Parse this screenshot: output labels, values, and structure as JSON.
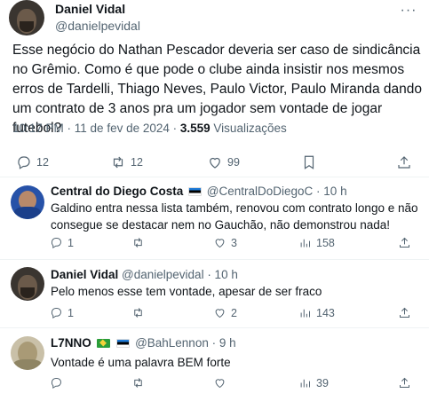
{
  "main_tweet": {
    "author_name": "Daniel Vidal",
    "author_handle": "@danielpevidal",
    "text": "Esse negócio do Nathan Pescador deveria ser caso de sindicância no Grêmio. Como é que pode o clube ainda insistir nos mesmos erros de Tardelli, Thiago Neves, Paulo Victor, Paulo Miranda dando um contrato de 3 anos pra um jogador sem vontade de jogar futebol?",
    "time": "10:17 PM · 11 de fev de 2024 · ",
    "views_count": "3.559",
    "views_label": " Visualizações",
    "replies": "12",
    "retweets": "12",
    "likes": "99"
  },
  "replies": [
    {
      "author_name": "Central do Diego Costa",
      "author_handle": "@CentralDoDiegoC · 10 h",
      "flag": "estonia",
      "text": "Galdino entra nessa lista também, renovou com contrato longo e não consegue se destacar nem no Gauchão, não demonstrou nada!",
      "replies": "1",
      "retweets": "",
      "likes": "3",
      "views": "158"
    },
    {
      "author_name": "Daniel Vidal",
      "author_handle": "@danielpevidal · 10 h",
      "text": "Pelo menos esse tem vontade, apesar de ser fraco",
      "replies": "1",
      "retweets": "",
      "likes": "2",
      "views": "143"
    },
    {
      "author_name": "L7NNO",
      "author_handle": "@BahLennon · 9 h",
      "flags": [
        "brazil",
        "estonia"
      ],
      "text": "Vontade é uma palavra BEM forte",
      "replies": "",
      "retweets": "",
      "likes": "",
      "views": "39"
    }
  ],
  "icons": [
    "more-icon",
    "reply-icon",
    "retweet-icon",
    "like-icon",
    "bookmark-icon",
    "share-icon",
    "views-icon"
  ],
  "colors": {
    "text": "#0f1419",
    "secondary": "#536471",
    "divider": "#eff3f4"
  }
}
